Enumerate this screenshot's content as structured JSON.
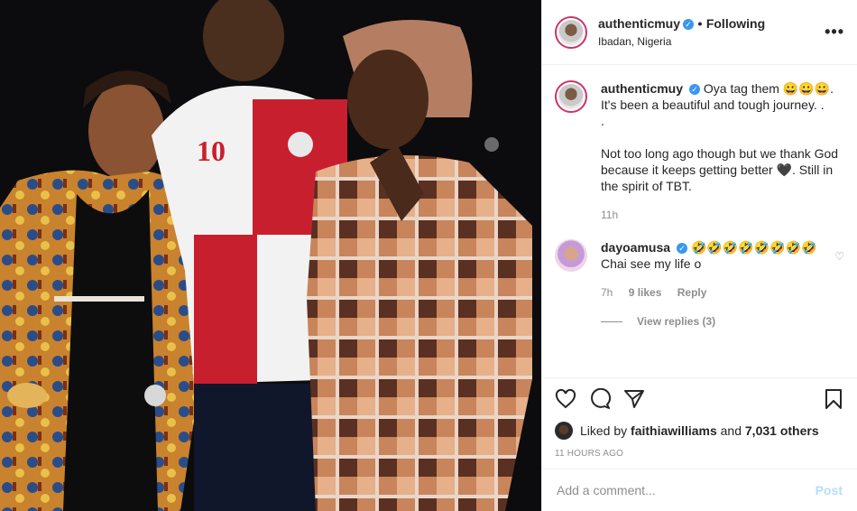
{
  "post": {
    "author": "authenticmuy",
    "follow_sep": "•",
    "follow_status": "Following",
    "location": "Ibadan, Nigeria",
    "more_label": "•••"
  },
  "caption": {
    "author": "authenticmuy",
    "line1": "Oya tag them 😀😀😀.",
    "line2": "It's been a beautiful and tough journey. .",
    "line3": ".",
    "line4": "Not too long ago though but we thank God because it keeps getting better 🖤. Still in the spirit of TBT.",
    "time": "11h"
  },
  "comment": {
    "author": "dayoamusa",
    "text": "🤣🤣🤣🤣🤣🤣🤣🤣 Chai see my life o",
    "time": "7h",
    "likes": "9 likes",
    "reply": "Reply",
    "view_replies": "View replies (3)"
  },
  "likes": {
    "prefix": "Liked by",
    "user": "faithiawilliams",
    "and": "and",
    "count": "7,031 others"
  },
  "timeago": "11 HOURS AGO",
  "add_comment": {
    "placeholder": "Add a comment...",
    "post": "Post"
  },
  "icons": {
    "like": "heart-icon",
    "comment": "comment-icon",
    "share": "share-icon",
    "save": "bookmark-icon",
    "verified": "verified-badge-icon"
  },
  "colors": {
    "accent": "#3897f0",
    "story_ring": "#c9356d",
    "post_disabled": "#b2dffc",
    "secondary_text": "#8e8e8e"
  }
}
